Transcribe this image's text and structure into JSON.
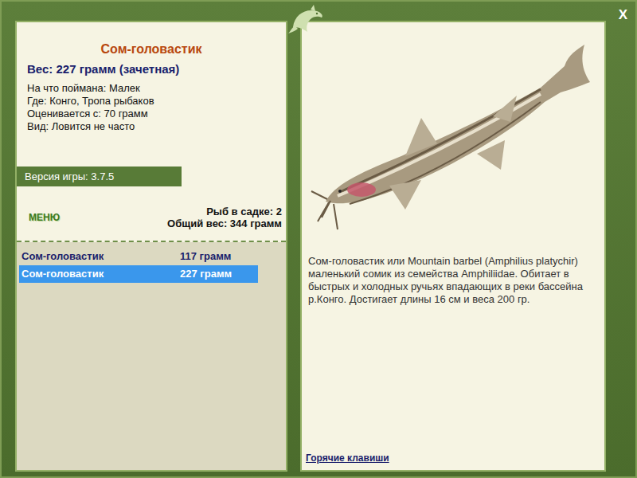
{
  "window": {
    "close": "X"
  },
  "fish": {
    "title": "Сом-головастик",
    "weight": "Вес: 227 грамм (зачетная)",
    "details": [
      "На что поймана: Малек",
      "Где: Конго, Тропа рыбаков",
      "Оценивается с: 70 грамм",
      "Вид: Ловится не часто"
    ]
  },
  "version": "Версия игры: 3.7.5",
  "menu": "МЕНЮ",
  "keepnet": {
    "count": "Рыб в садке: 2",
    "total": "Общий вес: 344 грамм"
  },
  "catch_list": [
    {
      "name": "Сом-головастик",
      "weight": "117 грамм",
      "selected": false
    },
    {
      "name": "Сом-головастик",
      "weight": "227 грамм",
      "selected": true
    }
  ],
  "description": "Сом-головастик или Mountain barbel (Amphilius platychir) маленький сомик из семейства Amphiliidae. Обитает в быстрых и холодных ручьях впадающих в реки бассейна р.Конго. Достигает длины 16 см и веса 200 гр.",
  "hotkeys": "Горячие клавиши"
}
